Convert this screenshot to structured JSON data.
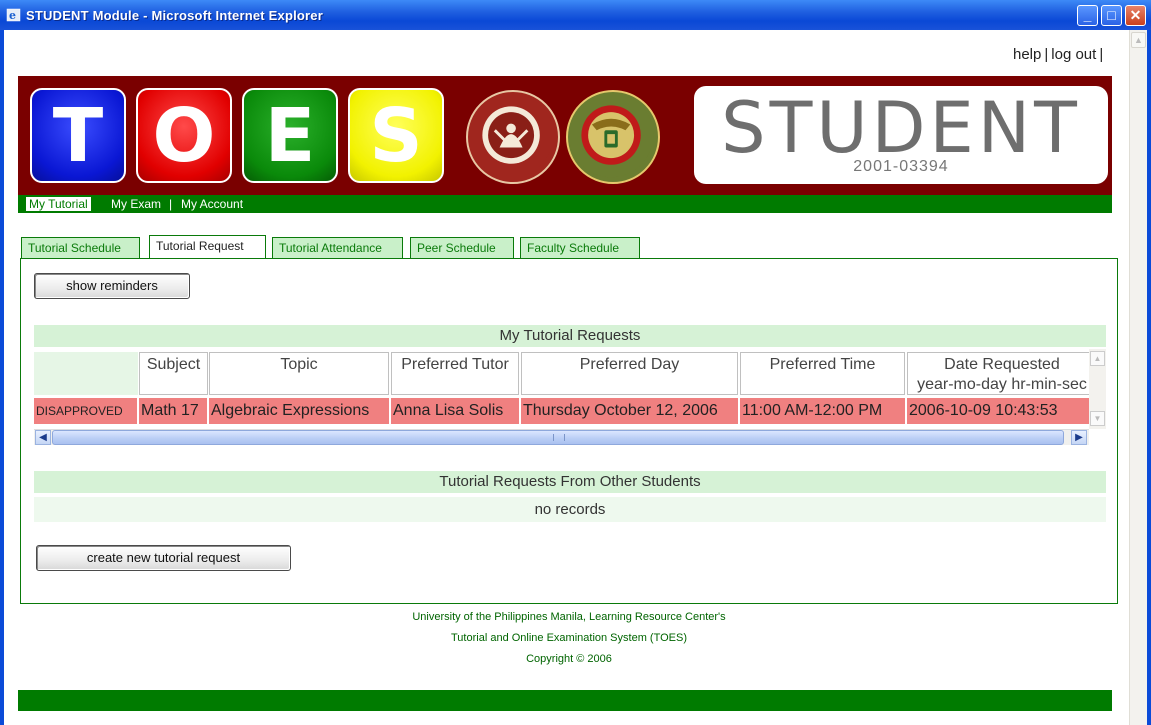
{
  "window": {
    "title": "STUDENT Module - Microsoft Internet Explorer",
    "minimize": "_",
    "maximize": "□",
    "close": "✕"
  },
  "toplinks": {
    "help": "help",
    "logout": "log out",
    "sep": "|"
  },
  "banner": {
    "letters": [
      "T",
      "O",
      "E",
      "S"
    ],
    "role": "STUDENT",
    "student_id": "2001-03394"
  },
  "menu": {
    "items": [
      "My Tutorial",
      "My Exam",
      "My Account"
    ],
    "separator": "|"
  },
  "tabs": [
    "Tutorial Schedule",
    "Tutorial Request",
    "Tutorial Attendance",
    "Peer Schedule",
    "Faculty Schedule"
  ],
  "buttons": {
    "show_reminders": "show reminders",
    "create_request": "create new tutorial request"
  },
  "my_requests": {
    "title": "My Tutorial Requests",
    "columns": [
      "",
      "Subject",
      "Topic",
      "Preferred Tutor",
      "Preferred Day",
      "Preferred Time",
      "Date Requested"
    ],
    "date_sub": "year-mo-day hr-min-sec",
    "rows": [
      {
        "status": "DISAPPROVED",
        "subject": "Math 17",
        "topic": "Algebraic Expressions",
        "tutor": "Anna Lisa Solis",
        "day": "Thursday October 12, 2006",
        "time": "11:00 AM-12:00 PM",
        "date_requested": "2006-10-09 10:43:53"
      }
    ]
  },
  "other_requests": {
    "title": "Tutorial Requests From Other Students",
    "empty": "no records"
  },
  "footer": {
    "line1": "University of the Philippines Manila, Learning Resource Center's",
    "line2": "Tutorial and Online Examination System (TOES)",
    "line3": "Copyright © 2006"
  },
  "colors": {
    "titlebar": "#0a48d6",
    "banner": "#7a0000",
    "green": "#007b00",
    "disapproved_row": "#f08080",
    "section_head": "#d6f2d6"
  }
}
